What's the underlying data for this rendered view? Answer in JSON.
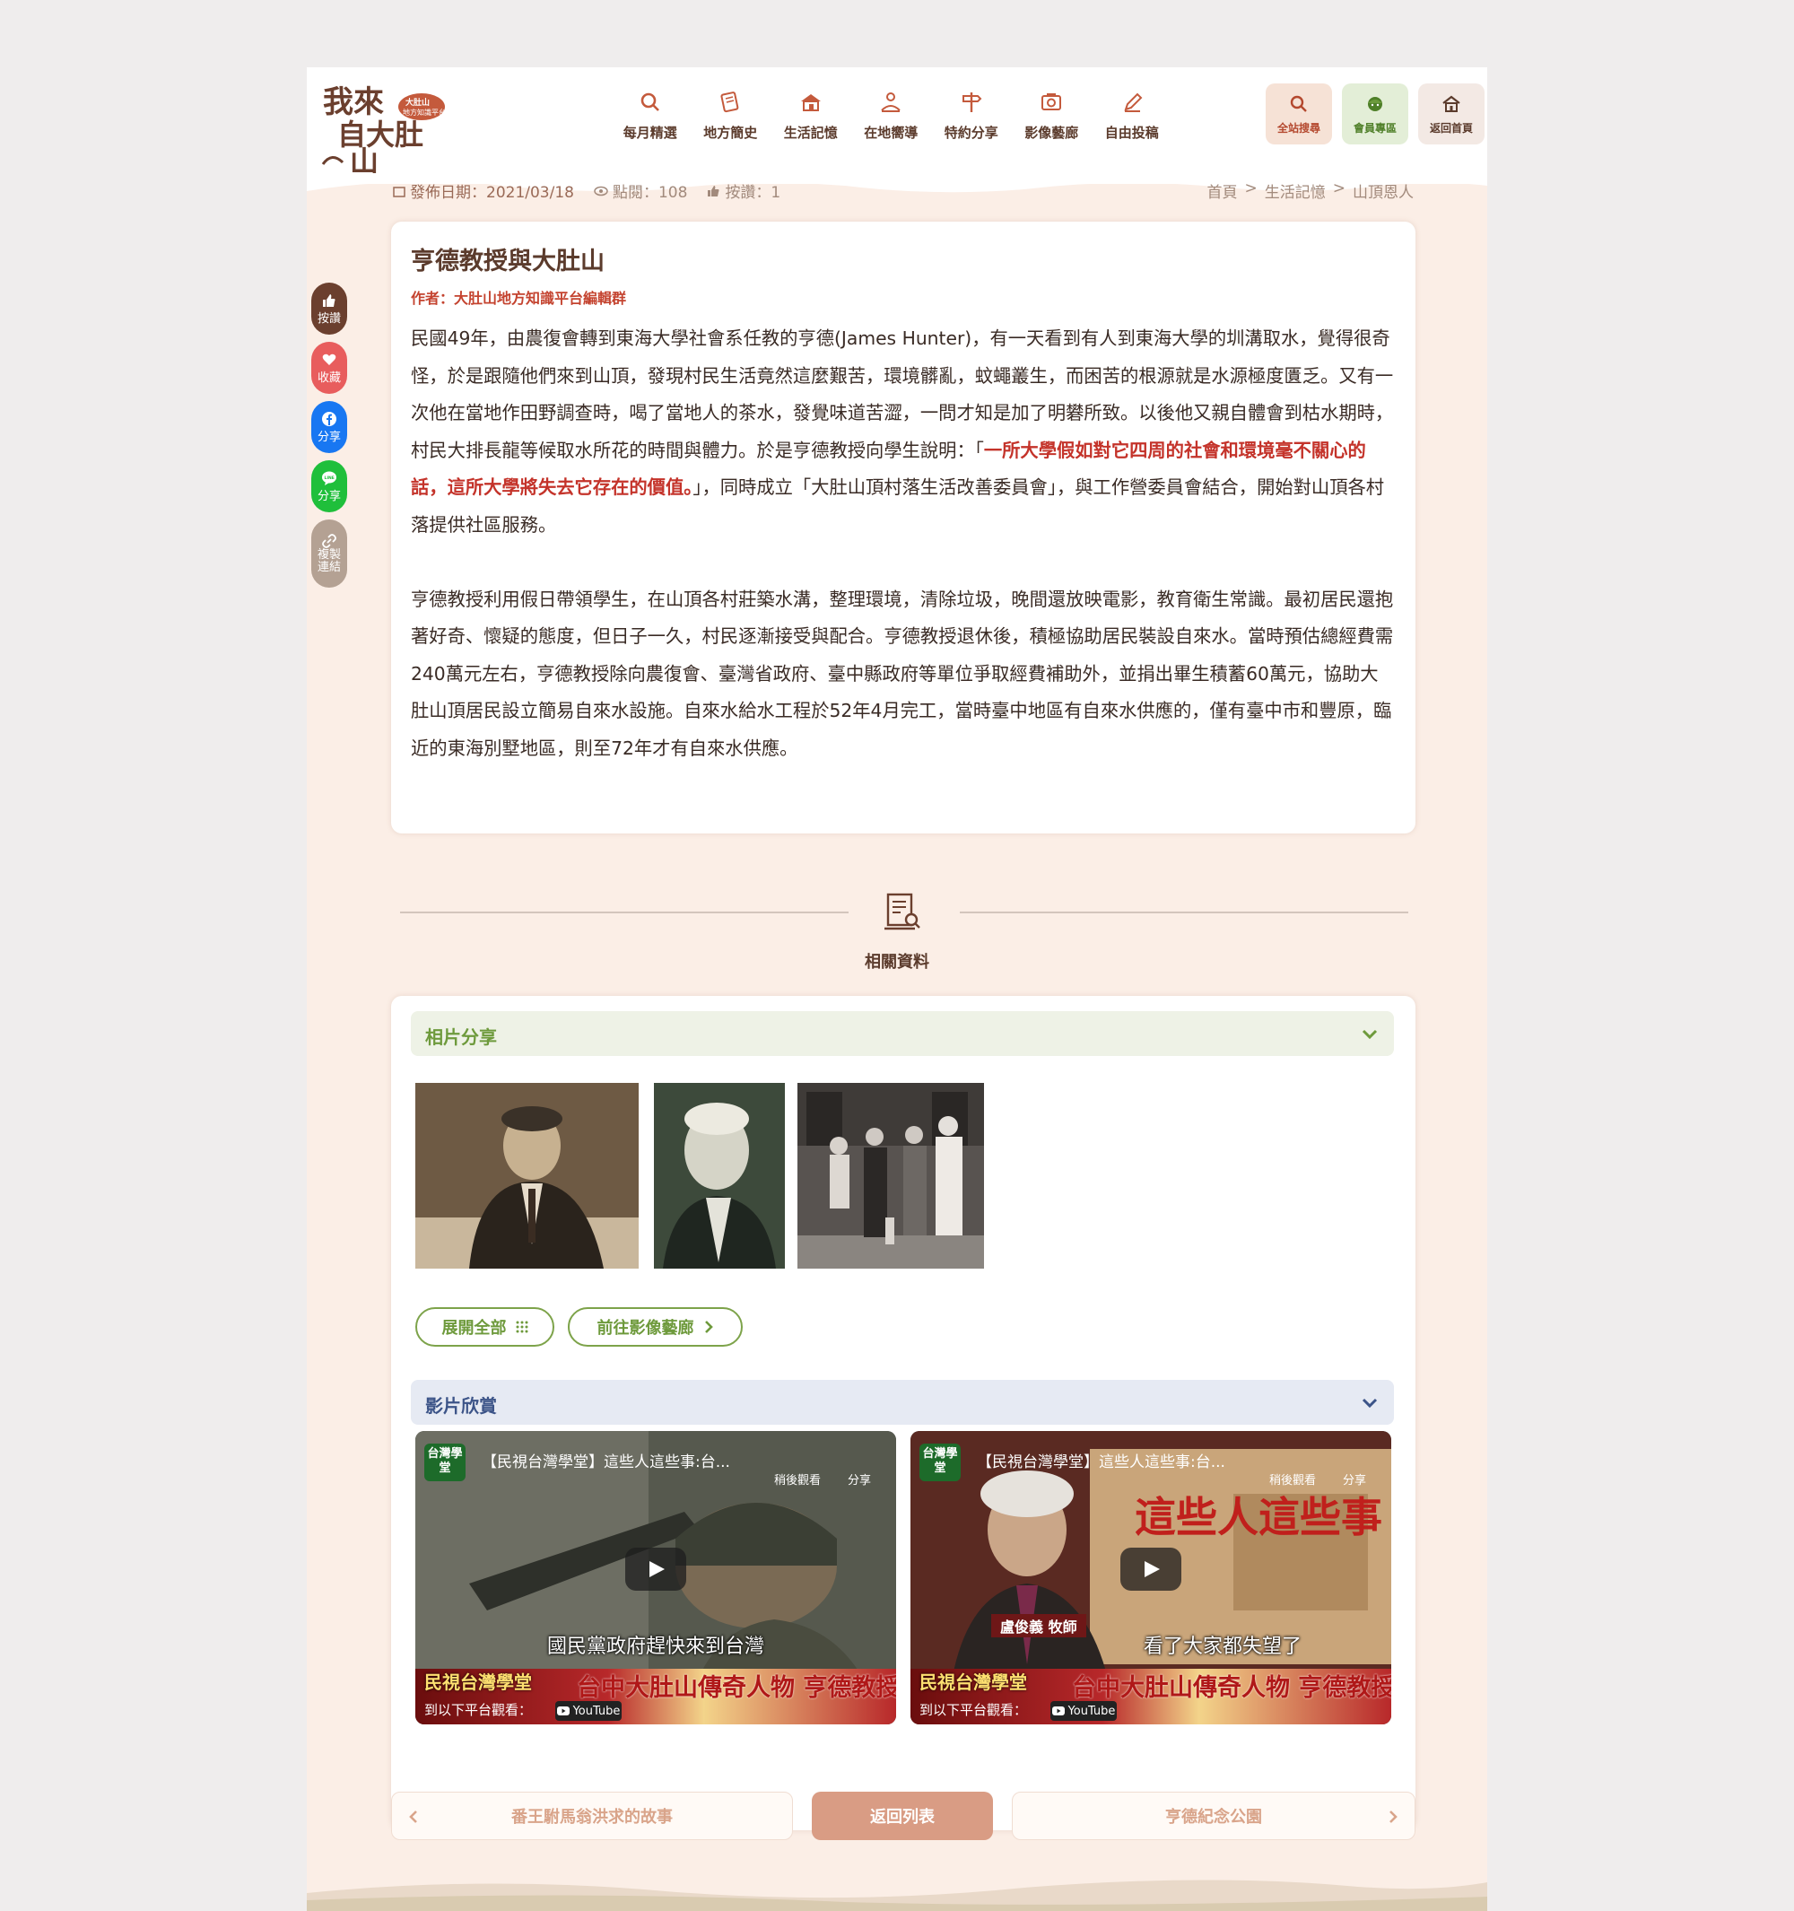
{
  "site": {
    "logo_text": "我來自大肚山",
    "logo_sub": "大肚山地方知識平台"
  },
  "nav": [
    {
      "label": "每月精選",
      "icon": "search-icon"
    },
    {
      "label": "地方簡史",
      "icon": "history-book-icon"
    },
    {
      "label": "生活記憶",
      "icon": "house-icon"
    },
    {
      "label": "在地嚮導",
      "icon": "guide-icon"
    },
    {
      "label": "特約分享",
      "icon": "signpost-icon"
    },
    {
      "label": "影像藝廊",
      "icon": "gallery-icon"
    },
    {
      "label": "自由投稿",
      "icon": "pencil-icon"
    }
  ],
  "quick": [
    {
      "label": "全站搜尋",
      "icon": "search-icon",
      "bg": "#f6e2d6",
      "color": "#b4482e"
    },
    {
      "label": "會員專區",
      "icon": "member-icon",
      "bg": "#e3eed7",
      "color": "#4e7f28"
    },
    {
      "label": "返回首頁",
      "icon": "home-icon",
      "bg": "#f3e9e4",
      "color": "#5b3b2c"
    }
  ],
  "meta": {
    "date": "發佈日期：2021/03/18",
    "views": "點閱：108",
    "likes": "按讚：1"
  },
  "breadcrumb": [
    "首頁",
    ">",
    "生活記憶",
    ">",
    "山頂恩人"
  ],
  "side_actions": [
    {
      "label": "按讚",
      "icon": "thumbs-up-icon",
      "bg": "#6b3f2e"
    },
    {
      "label": "收藏",
      "icon": "heart-icon",
      "bg": "#e85d5d"
    },
    {
      "label": "分享",
      "icon": "facebook-icon",
      "bg": "#1877f2"
    },
    {
      "label": "分享",
      "icon": "line-icon",
      "bg": "#1fbf3b"
    },
    {
      "label": "複製連結",
      "icon": "link-icon",
      "bg": "#b4a193"
    }
  ],
  "article": {
    "title": "亨德教授與大肚山",
    "author": "作者：大肚山地方知識平台編輯群",
    "p1_a": "民國49年，由農復會轉到東海大學社會系任教的亨德(James Hunter)，有一天看到有人到東海大學的圳溝取水，覺得很奇怪，於是跟隨他們來到山頂，發現村民生活竟然這麼艱苦，環境髒亂，蚊蠅叢生，而困苦的根源就是水源極度匱乏。又有一次他在當地作田野調查時，喝了當地人的茶水，發覺味道苦澀，一問才知是加了明礬所致。以後他又親自體會到枯水期時，村民大排長龍等候取水所花的時間與體力。於是亨德教授向學生說明：「",
    "p1_red": "一所大學假如對它四周的社會和環境毫不關心的話，這所大學將失去它存在的價值。",
    "p1_b": "」，同時成立「大肚山頂村落生活改善委員會」，與工作營委員會結合，開始對山頂各村落提供社區服務。",
    "p2": "亨德教授利用假日帶領學生，在山頂各村莊築水溝，整理環境，清除垃圾，晚間還放映電影，教育衛生常識。最初居民還抱著好奇、懷疑的態度，但日子一久，村民逐漸接受與配合。亨德教授退休後，積極協助居民裝設自來水。當時預估總經費需240萬元左右，亨德教授除向農復會、臺灣省政府、臺中縣政府等單位爭取經費補助外，並捐出畢生積蓄60萬元，協助大肚山頂居民設立簡易自來水設施。自來水給水工程於52年4月完工，當時臺中地區有自來水供應的，僅有臺中市和豐原，臨近的東海別墅地區，則至72年才有自來水供應。"
  },
  "related": {
    "title": "相關資料",
    "photos_title": "相片分享",
    "expand_all": "展開全部",
    "go_gallery": "前往影像藝廊",
    "videos_title": "影片欣賞",
    "videos": [
      {
        "badge": "台灣學堂",
        "title": "【民視台灣學堂】這些人這些事:台...",
        "later": "稍後觀看",
        "share": "分享",
        "subtitle": "國民黨政府趕快來到台灣",
        "station": "民視台灣學堂",
        "big": "台中大肚山傳奇人物 亨德教授（一）",
        "watch": "到以下平台觀看：",
        "yt": "YouTube"
      },
      {
        "badge": "台灣學堂",
        "title": "【民視台灣學堂】這些人這些事:台...",
        "later": "稍後觀看",
        "share": "分享",
        "subtitle": "看了大家都失望了",
        "station": "民視台灣學堂",
        "big": "台中大肚山傳奇人物 亨德教授（二）",
        "watch": "到以下平台觀看：",
        "yt": "YouTube",
        "speaker": "盧俊義 牧師",
        "overlay": "這些人這些事"
      }
    ]
  },
  "pager": {
    "prev": "番王駙馬翁洪求的故事",
    "list": "返回列表",
    "next": "亨德紀念公園"
  }
}
